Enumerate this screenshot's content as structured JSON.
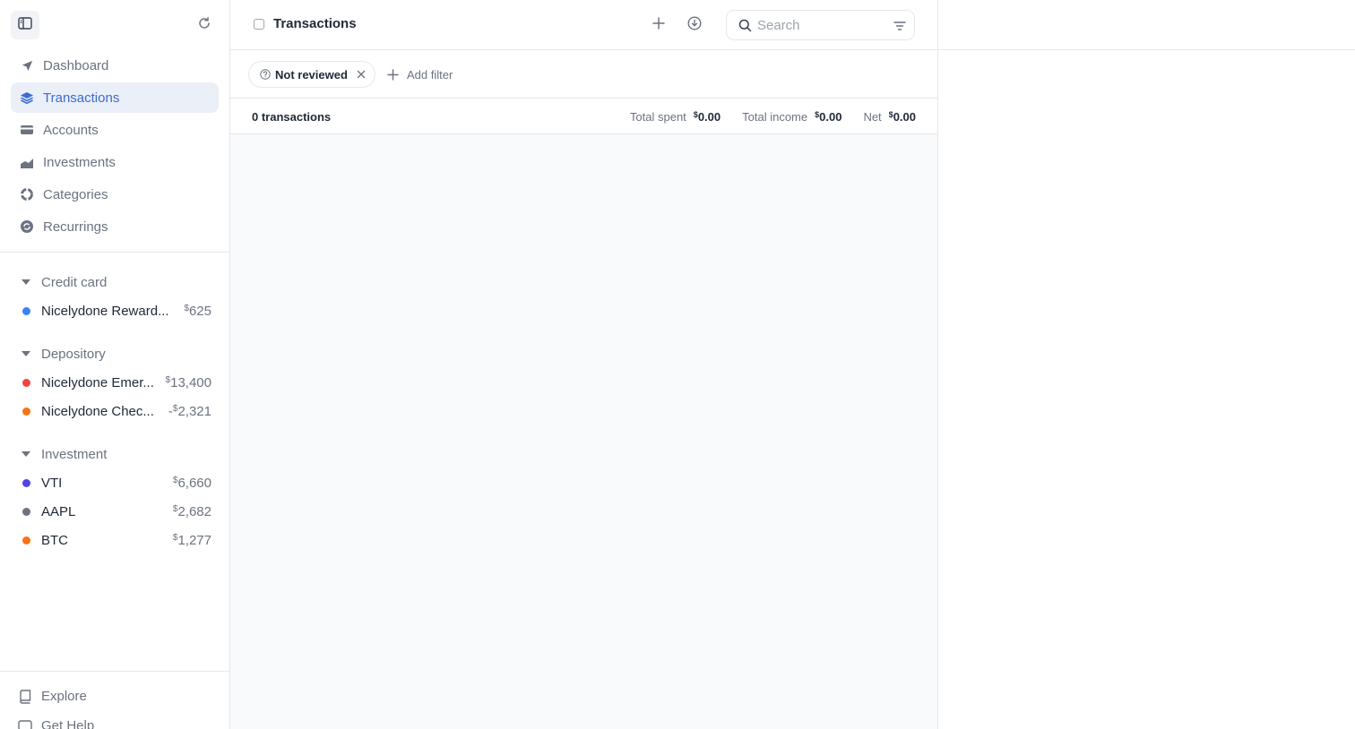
{
  "sidebar": {
    "nav": [
      {
        "label": "Dashboard",
        "icon": "send-icon"
      },
      {
        "label": "Transactions",
        "icon": "layers-icon",
        "active": true
      },
      {
        "label": "Accounts",
        "icon": "credit-card-icon"
      },
      {
        "label": "Investments",
        "icon": "chart-area-icon"
      },
      {
        "label": "Categories",
        "icon": "pie-icon"
      },
      {
        "label": "Recurrings",
        "icon": "repeat-icon"
      }
    ],
    "groups": [
      {
        "label": "Credit card",
        "accounts": [
          {
            "name": "Nicelydone Reward...",
            "amount_prefix": "",
            "currency": "$",
            "amount": "625",
            "color": "#3b82f6"
          }
        ]
      },
      {
        "label": "Depository",
        "accounts": [
          {
            "name": "Nicelydone Emer...",
            "amount_prefix": "",
            "currency": "$",
            "amount": "13,400",
            "color": "#ef4444"
          },
          {
            "name": "Nicelydone Chec...",
            "amount_prefix": "-",
            "currency": "$",
            "amount": "2,321",
            "color": "#f97316"
          }
        ]
      },
      {
        "label": "Investment",
        "accounts": [
          {
            "name": "VTI",
            "amount_prefix": "",
            "currency": "$",
            "amount": "6,660",
            "color": "#4f46e5"
          },
          {
            "name": "AAPL",
            "amount_prefix": "",
            "currency": "$",
            "amount": "2,682",
            "color": "#6b7280"
          },
          {
            "name": "BTC",
            "amount_prefix": "",
            "currency": "$",
            "amount": "1,277",
            "color": "#f97316"
          }
        ]
      }
    ],
    "footer": {
      "explore": "Explore",
      "help": "Get Help"
    }
  },
  "header": {
    "title": "Transactions",
    "search_placeholder": "Search"
  },
  "filters": {
    "chip_label": "Not reviewed",
    "add_filter_label": "Add filter"
  },
  "summary": {
    "count": "0 transactions",
    "total_spent_label": "Total spent",
    "total_spent_currency": "$",
    "total_spent": "0.00",
    "total_income_label": "Total income",
    "total_income_currency": "$",
    "total_income": "0.00",
    "net_label": "Net",
    "net_currency": "$",
    "net": "0.00"
  }
}
